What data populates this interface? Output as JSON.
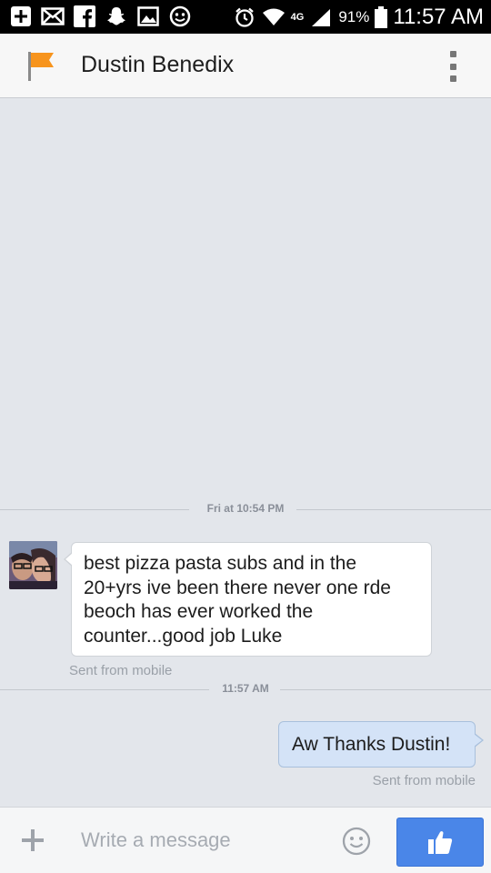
{
  "status_bar": {
    "network": "4G",
    "battery": "91%",
    "time": "11:57 AM",
    "left_icons": [
      "add-icon",
      "mail-icon",
      "facebook-icon",
      "snapchat-icon",
      "gallery-icon",
      "emoji-icon"
    ],
    "right_icons": [
      "alarm-icon",
      "wifi-icon",
      "signal-icon",
      "battery-icon"
    ]
  },
  "header": {
    "title": "Dustin Benedix",
    "flag_color": "#f7941d"
  },
  "conversation": {
    "divider_1": "Fri at 10:54 PM",
    "incoming_message": "best pizza pasta subs and in the 20+yrs ive been there never one rde beoch has ever worked the counter...good job Luke",
    "incoming_meta": "Sent from mobile",
    "divider_2": "11:57 AM",
    "outgoing_message": "Aw Thanks Dustin!",
    "outgoing_meta": "Sent from mobile"
  },
  "composer": {
    "placeholder": "Write a message",
    "value": "",
    "like_color": "#4a86e8"
  }
}
